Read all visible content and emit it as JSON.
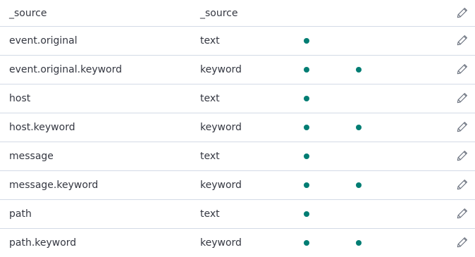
{
  "colors": {
    "indicator": "#017d73",
    "text": "#343741",
    "divider": "#d3dae6",
    "icon": "#69707d"
  },
  "rows": [
    {
      "name": "_source",
      "type": "_source",
      "searchable": false,
      "aggregatable": false
    },
    {
      "name": "event.original",
      "type": "text",
      "searchable": true,
      "aggregatable": false
    },
    {
      "name": "event.original.keyword",
      "type": "keyword",
      "searchable": true,
      "aggregatable": true
    },
    {
      "name": "host",
      "type": "text",
      "searchable": true,
      "aggregatable": false
    },
    {
      "name": "host.keyword",
      "type": "keyword",
      "searchable": true,
      "aggregatable": true
    },
    {
      "name": "message",
      "type": "text",
      "searchable": true,
      "aggregatable": false
    },
    {
      "name": "message.keyword",
      "type": "keyword",
      "searchable": true,
      "aggregatable": true
    },
    {
      "name": "path",
      "type": "text",
      "searchable": true,
      "aggregatable": false
    },
    {
      "name": "path.keyword",
      "type": "keyword",
      "searchable": true,
      "aggregatable": true
    }
  ],
  "icons": {
    "indicator": "dot-icon",
    "edit": "pencil-icon"
  }
}
